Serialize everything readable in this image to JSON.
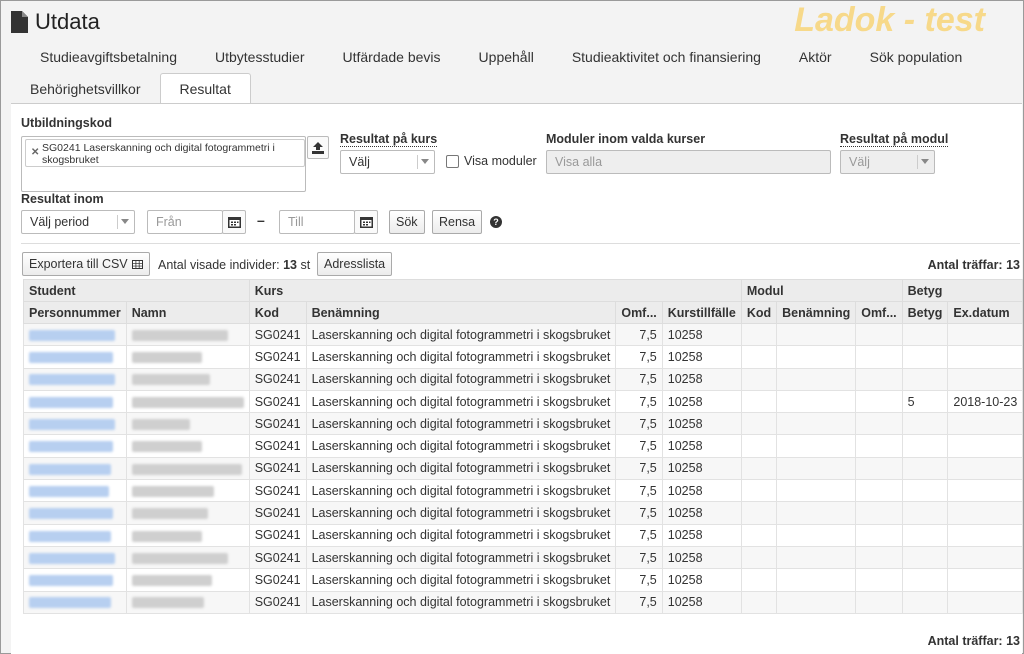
{
  "app": {
    "title": "Utdata",
    "watermark": "Ladok - test"
  },
  "tabs_row1": [
    "Studieavgiftsbetalning",
    "Utbytesstudier",
    "Utfärdade bevis",
    "Uppehåll",
    "Studieaktivitet och finansiering",
    "Aktör",
    "Sök population"
  ],
  "tabs_row2": [
    {
      "label": "Behörighetsvillkor",
      "active": false
    },
    {
      "label": "Resultat",
      "active": true
    }
  ],
  "filters": {
    "utbildningskod_label": "Utbildningskod",
    "utbildningskod_tag": "SG0241 Laserskanning och digital fotogrammetri i skogsbruket",
    "resultat_kurs_label": "Resultat på kurs",
    "resultat_kurs_value": "Välj",
    "visa_moduler_label": "Visa moduler",
    "moduler_label": "Moduler inom valda kurser",
    "moduler_placeholder": "Visa alla",
    "resultat_modul_label": "Resultat på modul",
    "resultat_modul_value": "Välj",
    "resultat_inom_label": "Resultat inom",
    "period_value": "Välj period",
    "from_placeholder": "Från",
    "dash": "–",
    "to_placeholder": "Till",
    "search_button": "Sök",
    "clear_button": "Rensa",
    "help_icon": "?"
  },
  "toolbar": {
    "export_label": "Exportera till CSV",
    "shown_label": "Antal visade individer:",
    "shown_count": "13",
    "shown_unit": "st",
    "address_button": "Adresslista",
    "hits_label": "Antal träffar:",
    "hits_count": "13"
  },
  "table": {
    "group_headers": [
      "Student",
      "Kurs",
      "Modul",
      "Betyg"
    ],
    "columns": [
      "Personnummer",
      "Namn",
      "Kod",
      "Benämning",
      "Omf...",
      "Kurstillfälle",
      "Kod",
      "Benämning",
      "Omf...",
      "Betyg",
      "Ex.datum"
    ],
    "rows": [
      {
        "kod": "SG0241",
        "benamning": "Laserskanning och digital fotogrammetri i skogsbruket",
        "omf": "7,5",
        "kurstillfalle": "10258",
        "betyg": "",
        "exdatum": ""
      },
      {
        "kod": "SG0241",
        "benamning": "Laserskanning och digital fotogrammetri i skogsbruket",
        "omf": "7,5",
        "kurstillfalle": "10258",
        "betyg": "",
        "exdatum": ""
      },
      {
        "kod": "SG0241",
        "benamning": "Laserskanning och digital fotogrammetri i skogsbruket",
        "omf": "7,5",
        "kurstillfalle": "10258",
        "betyg": "",
        "exdatum": ""
      },
      {
        "kod": "SG0241",
        "benamning": "Laserskanning och digital fotogrammetri i skogsbruket",
        "omf": "7,5",
        "kurstillfalle": "10258",
        "betyg": "5",
        "exdatum": "2018-10-23"
      },
      {
        "kod": "SG0241",
        "benamning": "Laserskanning och digital fotogrammetri i skogsbruket",
        "omf": "7,5",
        "kurstillfalle": "10258",
        "betyg": "",
        "exdatum": ""
      },
      {
        "kod": "SG0241",
        "benamning": "Laserskanning och digital fotogrammetri i skogsbruket",
        "omf": "7,5",
        "kurstillfalle": "10258",
        "betyg": "",
        "exdatum": ""
      },
      {
        "kod": "SG0241",
        "benamning": "Laserskanning och digital fotogrammetri i skogsbruket",
        "omf": "7,5",
        "kurstillfalle": "10258",
        "betyg": "",
        "exdatum": ""
      },
      {
        "kod": "SG0241",
        "benamning": "Laserskanning och digital fotogrammetri i skogsbruket",
        "omf": "7,5",
        "kurstillfalle": "10258",
        "betyg": "",
        "exdatum": ""
      },
      {
        "kod": "SG0241",
        "benamning": "Laserskanning och digital fotogrammetri i skogsbruket",
        "omf": "7,5",
        "kurstillfalle": "10258",
        "betyg": "",
        "exdatum": ""
      },
      {
        "kod": "SG0241",
        "benamning": "Laserskanning och digital fotogrammetri i skogsbruket",
        "omf": "7,5",
        "kurstillfalle": "10258",
        "betyg": "",
        "exdatum": ""
      },
      {
        "kod": "SG0241",
        "benamning": "Laserskanning och digital fotogrammetri i skogsbruket",
        "omf": "7,5",
        "kurstillfalle": "10258",
        "betyg": "",
        "exdatum": ""
      },
      {
        "kod": "SG0241",
        "benamning": "Laserskanning och digital fotogrammetri i skogsbruket",
        "omf": "7,5",
        "kurstillfalle": "10258",
        "betyg": "",
        "exdatum": ""
      },
      {
        "kod": "SG0241",
        "benamning": "Laserskanning och digital fotogrammetri i skogsbruket",
        "omf": "7,5",
        "kurstillfalle": "10258",
        "betyg": "",
        "exdatum": ""
      }
    ]
  },
  "footer": {
    "hits_label": "Antal träffar:",
    "hits_count": "13"
  },
  "colors": {
    "watermark": "#f7d98a",
    "link_blur": "#b7cff0",
    "header_bg": "#ececec"
  },
  "icons": {
    "title": "document-icon",
    "upload": "upload-icon",
    "calendar": "calendar-icon",
    "export": "table-icon",
    "help": "help-icon"
  }
}
